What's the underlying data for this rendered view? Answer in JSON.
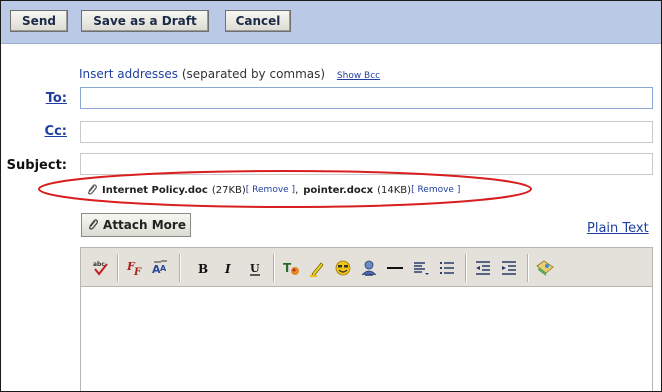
{
  "toolbar": {
    "send_label": "Send",
    "draft_label": "Save as a Draft",
    "cancel_label": "Cancel"
  },
  "address_hint": {
    "link_text": "Insert addresses",
    "note": "(separated by commas)",
    "show_bcc": "Show Bcc"
  },
  "fields": {
    "to_label": "To:",
    "to_value": "",
    "cc_label": "Cc:",
    "cc_value": "",
    "subject_label": "Subject:",
    "subject_value": ""
  },
  "attachments": [
    {
      "name": "Internet Policy.doc",
      "size": "(27KB)",
      "remove": "[ Remove ]"
    },
    {
      "name": "pointer.docx",
      "size": "(14KB)",
      "remove": "[ Remove ]"
    }
  ],
  "attach_more_label": "Attach More",
  "plain_text_label": "Plain Text",
  "editor_tools": [
    "spellcheck-icon",
    "font-icon",
    "font-size-icon",
    "bold-icon",
    "italic-icon",
    "underline-icon",
    "text-color-icon",
    "highlight-icon",
    "emoticon-icon",
    "link-icon",
    "horizontal-rule-icon",
    "align-icon",
    "bullet-list-icon",
    "outdent-icon",
    "indent-icon",
    "image-icon"
  ],
  "editor_body": "",
  "colors": {
    "toolbar_bg": "#b9c9e6",
    "link": "#1f3fa0",
    "highlight_ellipse": "#d81e1e"
  }
}
